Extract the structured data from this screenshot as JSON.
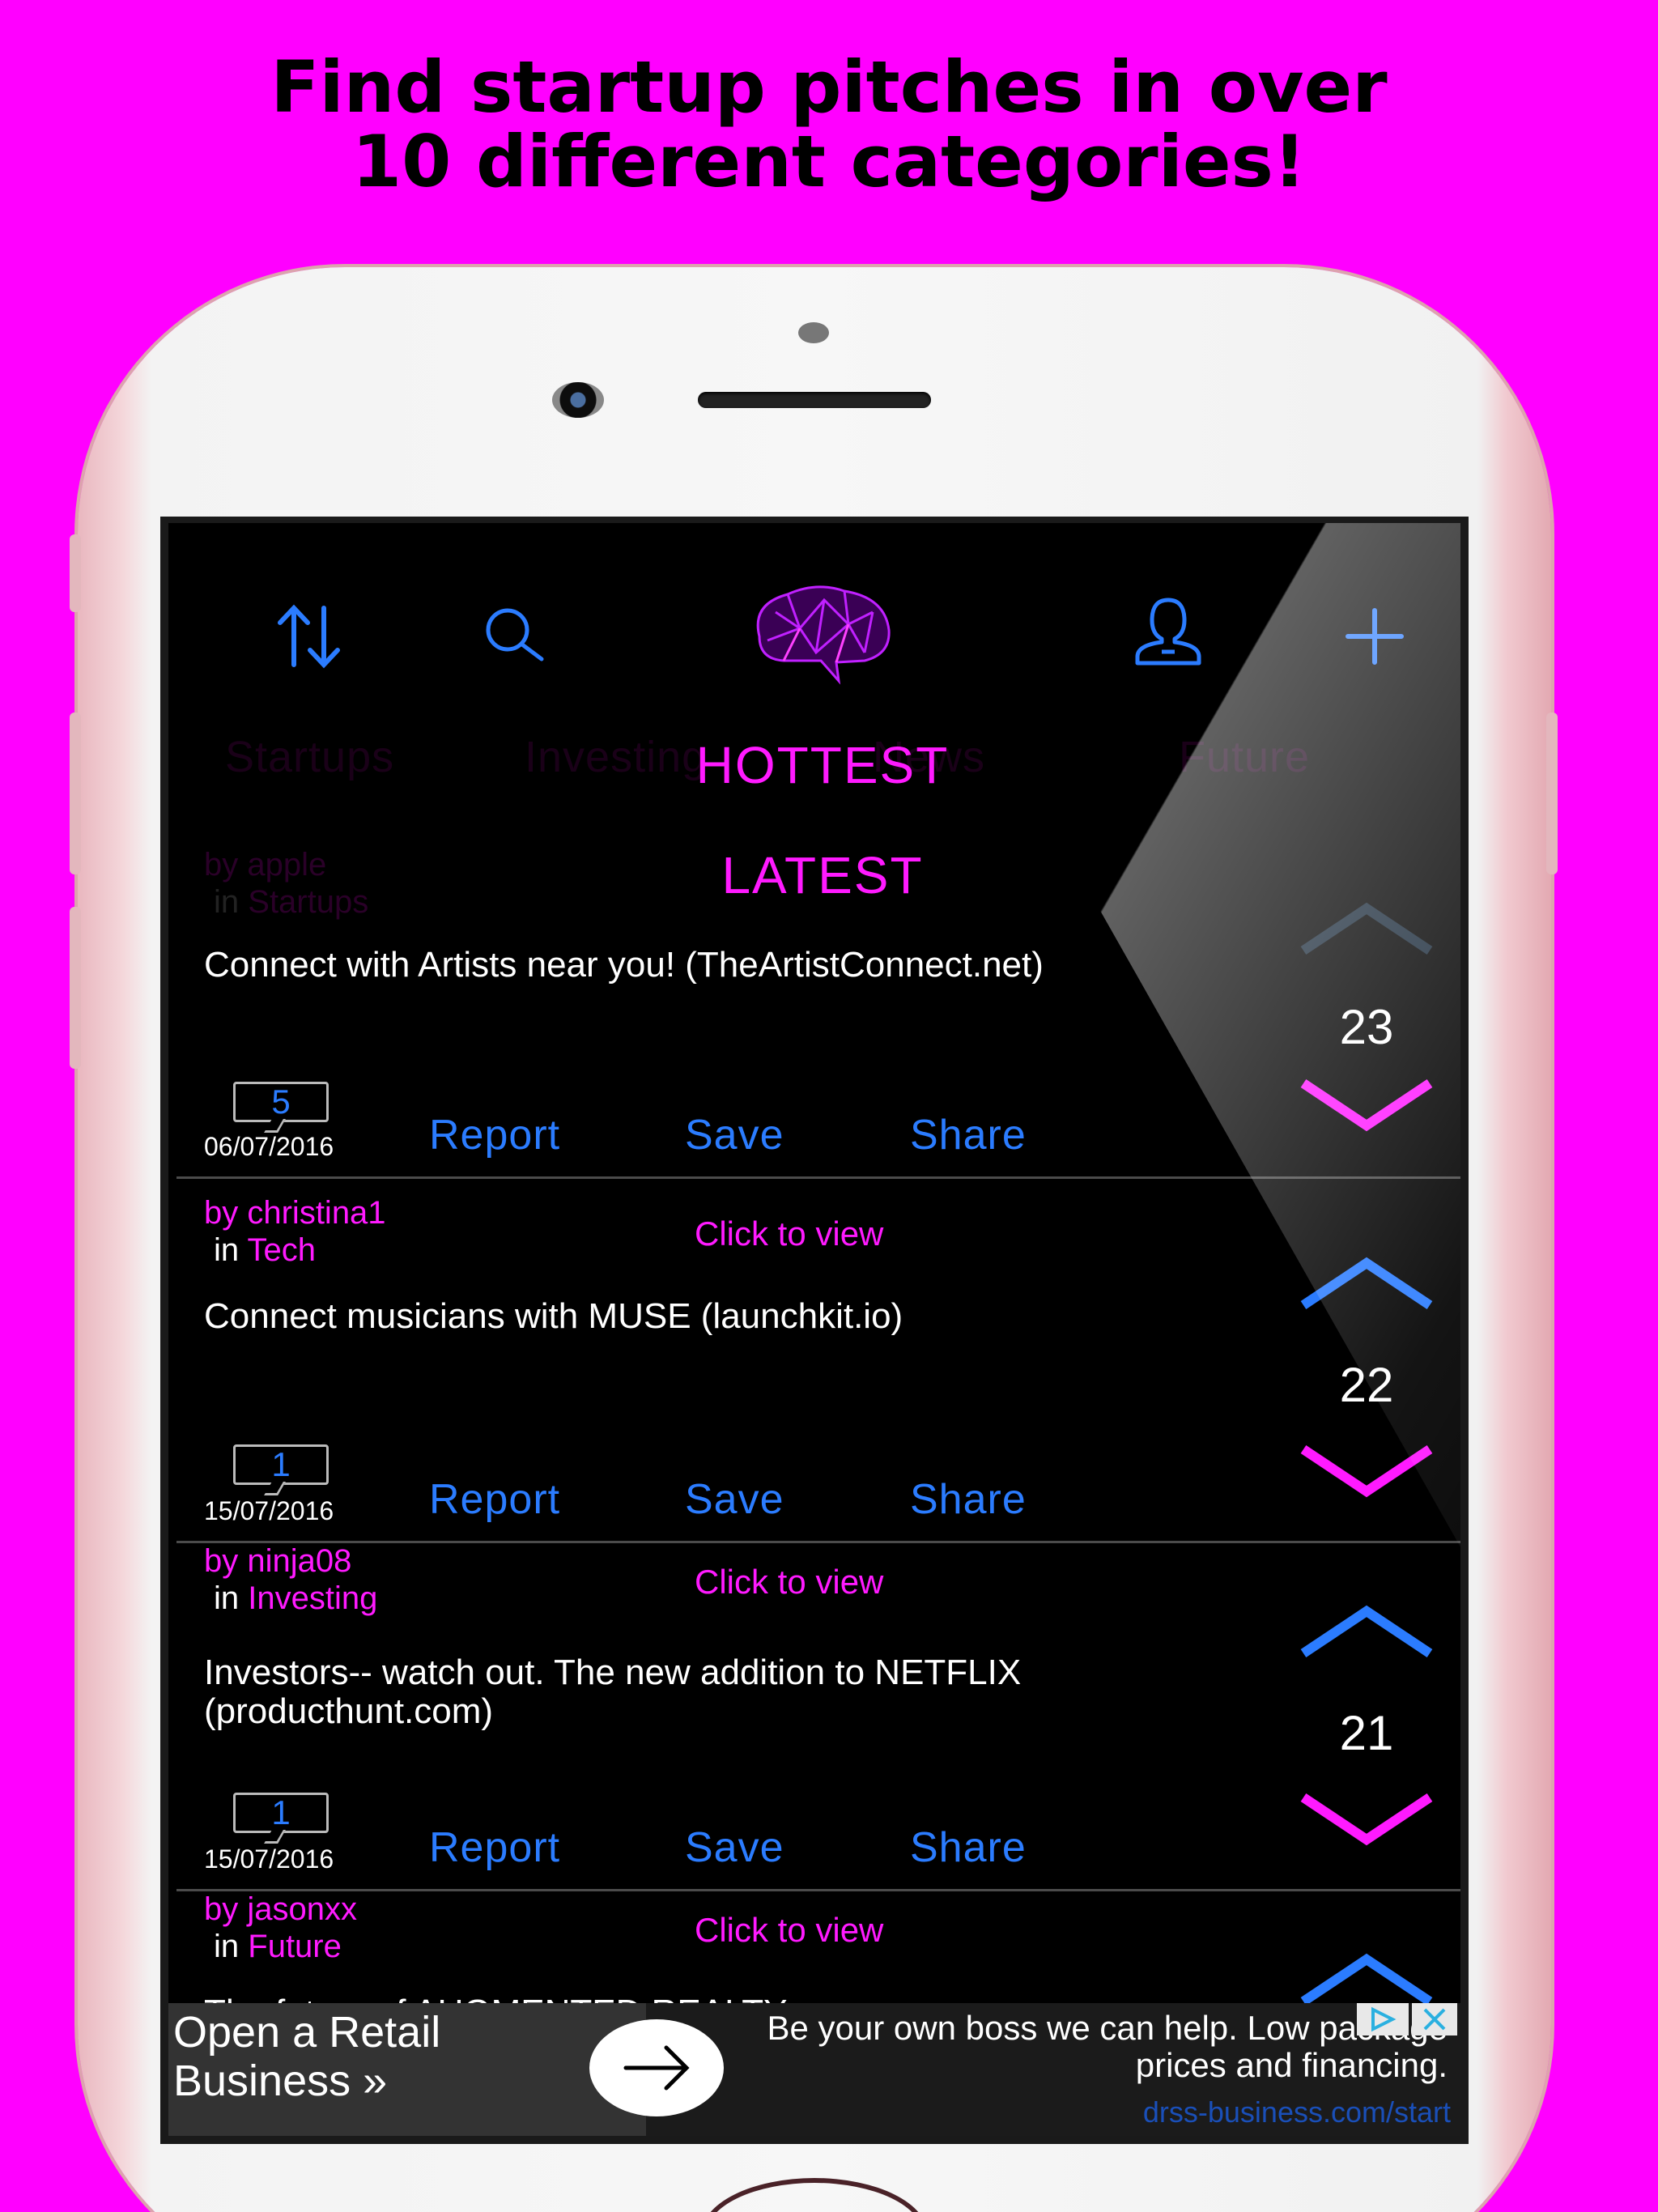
{
  "promo": {
    "line1": "Find startup pitches in over",
    "line2": "10 different categories!"
  },
  "nav": {
    "icons": [
      "sort-arrows-icon",
      "search-icon",
      "brain-logo-icon",
      "profile-icon",
      "plus-icon"
    ]
  },
  "categories": [
    "Startups",
    "Investing",
    "News",
    "Future"
  ],
  "sort_menu": {
    "hottest": "HOTTEST",
    "latest": "LATEST"
  },
  "posts": [
    {
      "author": "by apple",
      "in": "in",
      "category": "Startups",
      "title": "Connect with Artists near you! (TheArtistConnect.net)",
      "comments": "5",
      "date": "06/07/2016",
      "score": "23",
      "report": "Report",
      "save": "Save",
      "share": "Share"
    },
    {
      "author": "by christina1",
      "in": "in",
      "category": "Tech",
      "click": "Click to view",
      "title": "Connect musicians with MUSE (launchkit.io)",
      "comments": "1",
      "date": "15/07/2016",
      "score": "22",
      "report": "Report",
      "save": "Save",
      "share": "Share"
    },
    {
      "author": "by ninja08",
      "in": "in",
      "category": "Investing",
      "click": "Click to view",
      "title": "Investors-- watch out. The new addition to NETFLIX (producthunt.com)",
      "comments": "1",
      "date": "15/07/2016",
      "score": "21",
      "report": "Report",
      "save": "Save",
      "share": "Share"
    },
    {
      "author": "by jasonxx",
      "in": "in",
      "category": "Future",
      "click": "Click to view",
      "title": "The future of AUGMENTED REALTY"
    }
  ],
  "ad": {
    "headline": "Open a Retail Business »",
    "body": "Be your own boss we can help. Low package prices and financing.",
    "url": "drss-business.com/start"
  },
  "colors": {
    "background": "#ff00ff",
    "accent_pink": "#ff1aff",
    "accent_blue": "#2b7cff",
    "screen": "#000000"
  }
}
